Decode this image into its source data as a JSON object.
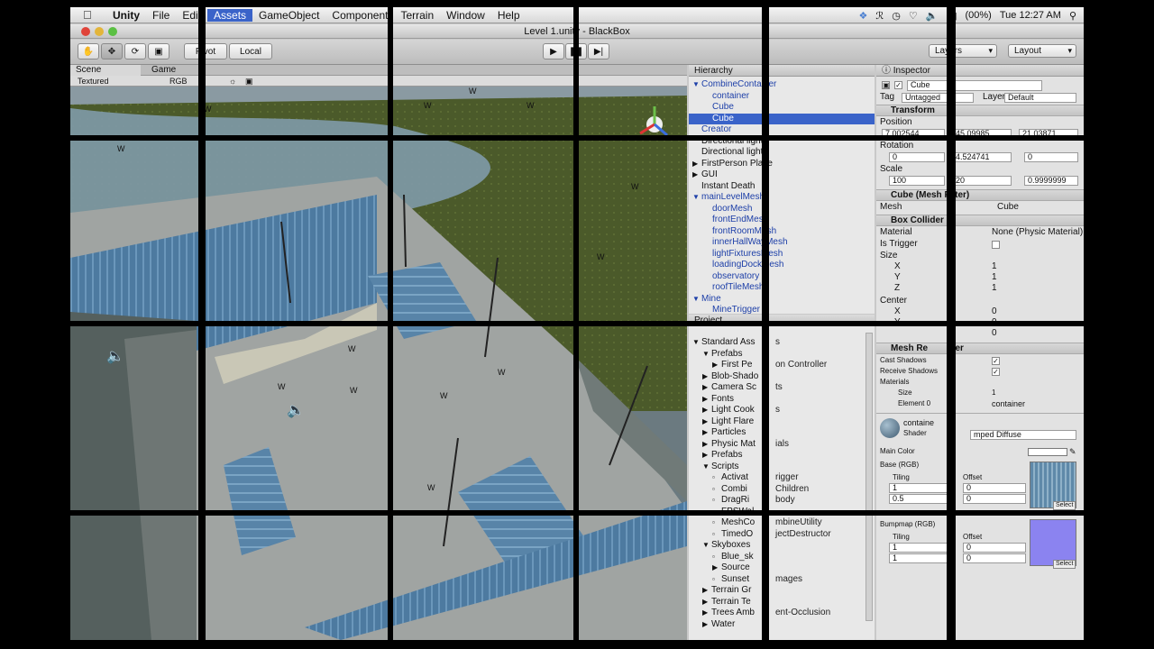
{
  "menubar": {
    "items": [
      "Unity",
      "File",
      "Edit",
      "Assets",
      "GameObject",
      "Component",
      "Terrain",
      "Window",
      "Help"
    ],
    "active_index": 3,
    "battery": "(00%)",
    "clock": "Tue 12:27 AM"
  },
  "window": {
    "title": "Level 1.unity - BlackBox"
  },
  "toolbar": {
    "pivot_label": "Pivot",
    "local_label": "Local",
    "layers_label": "Layers",
    "layout_label": "Layout"
  },
  "scene": {
    "tab_scene": "Scene",
    "tab_game": "Game",
    "render_mode": "Textured",
    "color_mode": "RGB"
  },
  "hierarchy": {
    "title": "Hierarchy",
    "items": [
      {
        "label": "CombineContainer",
        "indent": 0,
        "arrow": "▼",
        "style": "blue"
      },
      {
        "label": "container",
        "indent": 1,
        "arrow": "",
        "style": "blue"
      },
      {
        "label": "Cube",
        "indent": 1,
        "arrow": "",
        "style": "blue"
      },
      {
        "label": "Cube",
        "indent": 1,
        "arrow": "",
        "style": "sel"
      },
      {
        "label": "Creator",
        "indent": 0,
        "arrow": "",
        "style": "blue"
      },
      {
        "label": "Directional light",
        "indent": 0,
        "arrow": "",
        "style": ""
      },
      {
        "label": "Directional light",
        "indent": 0,
        "arrow": "",
        "style": ""
      },
      {
        "label": "FirstPerson Playe",
        "indent": 0,
        "arrow": "▶",
        "style": ""
      },
      {
        "label": "GUI",
        "indent": 0,
        "arrow": "▶",
        "style": ""
      },
      {
        "label": "Instant Death",
        "indent": 0,
        "arrow": "",
        "style": ""
      },
      {
        "label": "mainLevelMesh",
        "indent": 0,
        "arrow": "▼",
        "style": "blue"
      },
      {
        "label": "doorMesh",
        "indent": 1,
        "arrow": "",
        "style": "blue"
      },
      {
        "label": "frontEndMesh",
        "indent": 1,
        "arrow": "",
        "style": "blue"
      },
      {
        "label": "frontRoomMesh",
        "indent": 1,
        "arrow": "",
        "style": "blue"
      },
      {
        "label": "innerHallWayMesh",
        "indent": 1,
        "arrow": "",
        "style": "blue"
      },
      {
        "label": "lightFixturesMesh",
        "indent": 1,
        "arrow": "",
        "style": "blue"
      },
      {
        "label": "loadingDockMesh",
        "indent": 1,
        "arrow": "",
        "style": "blue"
      },
      {
        "label": "observatory",
        "indent": 1,
        "arrow": "",
        "style": "blue"
      },
      {
        "label": "roofTileMesh",
        "indent": 1,
        "arrow": "",
        "style": "blue"
      },
      {
        "label": "Mine",
        "indent": 0,
        "arrow": "▼",
        "style": "blue"
      },
      {
        "label": "MineTrigger",
        "indent": 1,
        "arrow": "",
        "style": "blue"
      }
    ]
  },
  "project": {
    "title": "Project",
    "items": [
      {
        "label": "Standard Ass",
        "indent": 0,
        "arrow": "▼"
      },
      {
        "label": "Prefabs",
        "indent": 1,
        "arrow": "▼"
      },
      {
        "label": "First Pe",
        "indent": 2,
        "arrow": "▶"
      },
      {
        "label": "Blob-Shado",
        "indent": 1,
        "arrow": "▶"
      },
      {
        "label": "Camera Sc",
        "indent": 1,
        "arrow": "▶"
      },
      {
        "label": "Fonts",
        "indent": 1,
        "arrow": "▶"
      },
      {
        "label": "Light Cook",
        "indent": 1,
        "arrow": "▶"
      },
      {
        "label": "Light Flare",
        "indent": 1,
        "arrow": "▶"
      },
      {
        "label": "Particles",
        "indent": 1,
        "arrow": "▶"
      },
      {
        "label": "Physic Mat",
        "indent": 1,
        "arrow": "▶"
      },
      {
        "label": "Prefabs",
        "indent": 1,
        "arrow": "▶"
      },
      {
        "label": "Scripts",
        "indent": 1,
        "arrow": "▼"
      },
      {
        "label": "Activat",
        "indent": 2,
        "arrow": ""
      },
      {
        "label": "Combi",
        "indent": 2,
        "arrow": ""
      },
      {
        "label": "DragRi",
        "indent": 2,
        "arrow": ""
      },
      {
        "label": "FPSWal",
        "indent": 2,
        "arrow": ""
      },
      {
        "label": "MeshCo",
        "indent": 2,
        "arrow": ""
      },
      {
        "label": "TimedO",
        "indent": 2,
        "arrow": ""
      },
      {
        "label": "Skyboxes",
        "indent": 1,
        "arrow": "▼"
      },
      {
        "label": "Blue_sk",
        "indent": 2,
        "arrow": ""
      },
      {
        "label": "Source",
        "indent": 2,
        "arrow": "▶"
      },
      {
        "label": "Sunset",
        "indent": 2,
        "arrow": ""
      },
      {
        "label": "Terrain Gr",
        "indent": 1,
        "arrow": "▶"
      },
      {
        "label": "Terrain Te",
        "indent": 1,
        "arrow": "▶"
      },
      {
        "label": "Trees Amb",
        "indent": 1,
        "arrow": "▶"
      },
      {
        "label": "Water",
        "indent": 1,
        "arrow": "▶"
      }
    ],
    "fragments": [
      "s",
      "on Controller",
      "ts",
      "s",
      "ials",
      "rigger",
      "Children",
      "body",
      "mbineUtility",
      "jectDestructor",
      "mages",
      "ent-Occlusion"
    ]
  },
  "inspector": {
    "title": "Inspector",
    "object_name": "Cube",
    "tag_label": "Tag",
    "tag_value": "Untagged",
    "layer_label": "Layer",
    "layer_value": "Default",
    "transform": {
      "header": "Transform",
      "position_label": "Position",
      "position": {
        "x": "7.002544",
        "y": "45.09985",
        "z": "21.03871"
      },
      "rotation_label": "Rotation",
      "rotation": {
        "x": "0",
        "y": "4.524741",
        "z": "0"
      },
      "scale_label": "Scale",
      "scale": {
        "x": "100",
        "y": "20",
        "z": "0.9999999"
      }
    },
    "mesh_filter": {
      "header": "Cube (Mesh Filter)",
      "mesh_label": "Mesh",
      "mesh_value": "Cube"
    },
    "box_collider": {
      "header": "Box Collider",
      "material_label": "Material",
      "material_value": "None (Physic Material)",
      "is_trigger_label": "Is Trigger",
      "size_label": "Size",
      "size": {
        "x": "1",
        "y": "1",
        "z": "1"
      },
      "center_label": "Center",
      "center": {
        "x": "0",
        "y": "0",
        "z": "0"
      }
    },
    "mesh_renderer": {
      "header": "Mesh Re",
      "header_tail": "erer",
      "cast_shadows": "Cast Shadows",
      "receive_shadows": "Receive Shadows",
      "materials_label": "Materials",
      "size_label": "Size",
      "size_value": "1",
      "element_label": "Element 0",
      "element_value": "container"
    },
    "material": {
      "name": "containe",
      "shader_label": "Shader",
      "shader_value": "mped Diffuse",
      "main_color": "Main Color",
      "base_label": "Base (RGB)",
      "tiling_label": "Tiling",
      "offset_label": "Offset",
      "tiling": {
        "x": "1",
        "y": "0.5"
      },
      "offset": {
        "x": "0",
        "y": "0"
      },
      "bump_label": "Bumpmap (RGB)",
      "bump_tiling": {
        "x": "1",
        "y": "1"
      },
      "bump_offset": {
        "x": "0",
        "y": "0"
      },
      "select_label": "Select"
    }
  },
  "colors": {
    "selection": "#3a63c9",
    "bump_texture": "#8b83f0",
    "base_texture": "#5f89a9"
  },
  "icons": [
    "apple-icon",
    "hand-tool-icon",
    "move-tool-icon",
    "rotate-tool-icon",
    "scale-tool-icon",
    "play-icon",
    "pause-icon",
    "step-icon",
    "speaker-icon",
    "scene-gizmo-icon"
  ]
}
